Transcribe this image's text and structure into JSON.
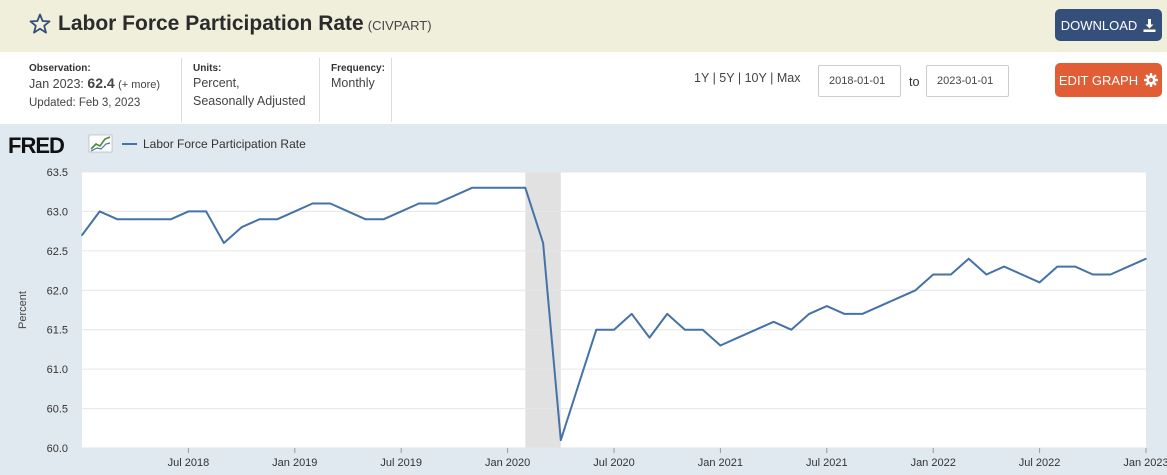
{
  "header": {
    "title": "Labor Force Participation Rate",
    "series_code": "(CIVPART)",
    "download_label": "DOWNLOAD",
    "download_icon": "download-icon"
  },
  "info": {
    "observation_label": "Observation:",
    "observation_date": "Jan 2023:",
    "observation_value": "62.4",
    "observation_more": "(+ more)",
    "updated": "Updated: Feb 3, 2023",
    "units_label": "Units:",
    "units_line1": "Percent,",
    "units_line2": "Seasonally Adjusted",
    "frequency_label": "Frequency:",
    "frequency_value": "Monthly"
  },
  "controls": {
    "range_1y": "1Y",
    "range_5y": "5Y",
    "range_10y": "10Y",
    "range_max": "Max",
    "sep": "|",
    "start_date": "2018-01-01",
    "to_label": "to",
    "end_date": "2023-01-01",
    "edit_label": "EDIT GRAPH",
    "edit_icon": "gear-icon"
  },
  "logo_text": "FRED",
  "colors": {
    "line": "#4572a7",
    "title_bg": "#efefdb",
    "graph_bg": "#e1e9f0",
    "recession": "#e1e1e1",
    "download": "#34507a",
    "edit": "#e05d35"
  },
  "chart_data": {
    "type": "line",
    "ylabel": "Percent",
    "ylim": [
      60.0,
      63.5
    ],
    "yticks": [
      "63.5",
      "63.0",
      "62.5",
      "62.0",
      "61.5",
      "61.0",
      "60.5",
      "60.0"
    ],
    "xticks": [
      {
        "label": "Jul 2018",
        "date": "2018-07"
      },
      {
        "label": "Jan 2019",
        "date": "2019-01"
      },
      {
        "label": "Jul 2019",
        "date": "2019-07"
      },
      {
        "label": "Jan 2020",
        "date": "2020-01"
      },
      {
        "label": "Jul 2020",
        "date": "2020-07"
      },
      {
        "label": "Jan 2021",
        "date": "2021-01"
      },
      {
        "label": "Jul 2021",
        "date": "2021-07"
      },
      {
        "label": "Jan 2022",
        "date": "2022-01"
      },
      {
        "label": "Jul 2022",
        "date": "2022-07"
      },
      {
        "label": "Jan 2023",
        "date": "2023-01"
      }
    ],
    "recession": [
      "2020-02",
      "2020-04"
    ],
    "grid": true,
    "series": [
      {
        "name": "Labor Force Participation Rate",
        "start": "2018-01",
        "values": [
          62.7,
          63.0,
          62.9,
          62.9,
          62.9,
          62.9,
          63.0,
          63.0,
          62.6,
          62.8,
          62.9,
          62.9,
          63.0,
          63.1,
          63.1,
          63.0,
          62.9,
          62.9,
          63.0,
          63.1,
          63.1,
          63.2,
          63.3,
          63.3,
          63.3,
          63.3,
          62.6,
          60.1,
          60.8,
          61.5,
          61.5,
          61.7,
          61.4,
          61.7,
          61.5,
          61.5,
          61.3,
          61.4,
          61.5,
          61.6,
          61.5,
          61.7,
          61.8,
          61.7,
          61.7,
          61.8,
          61.9,
          62.0,
          62.2,
          62.2,
          62.4,
          62.2,
          62.3,
          62.2,
          62.1,
          62.3,
          62.3,
          62.2,
          62.2,
          62.3,
          62.4
        ]
      }
    ]
  }
}
